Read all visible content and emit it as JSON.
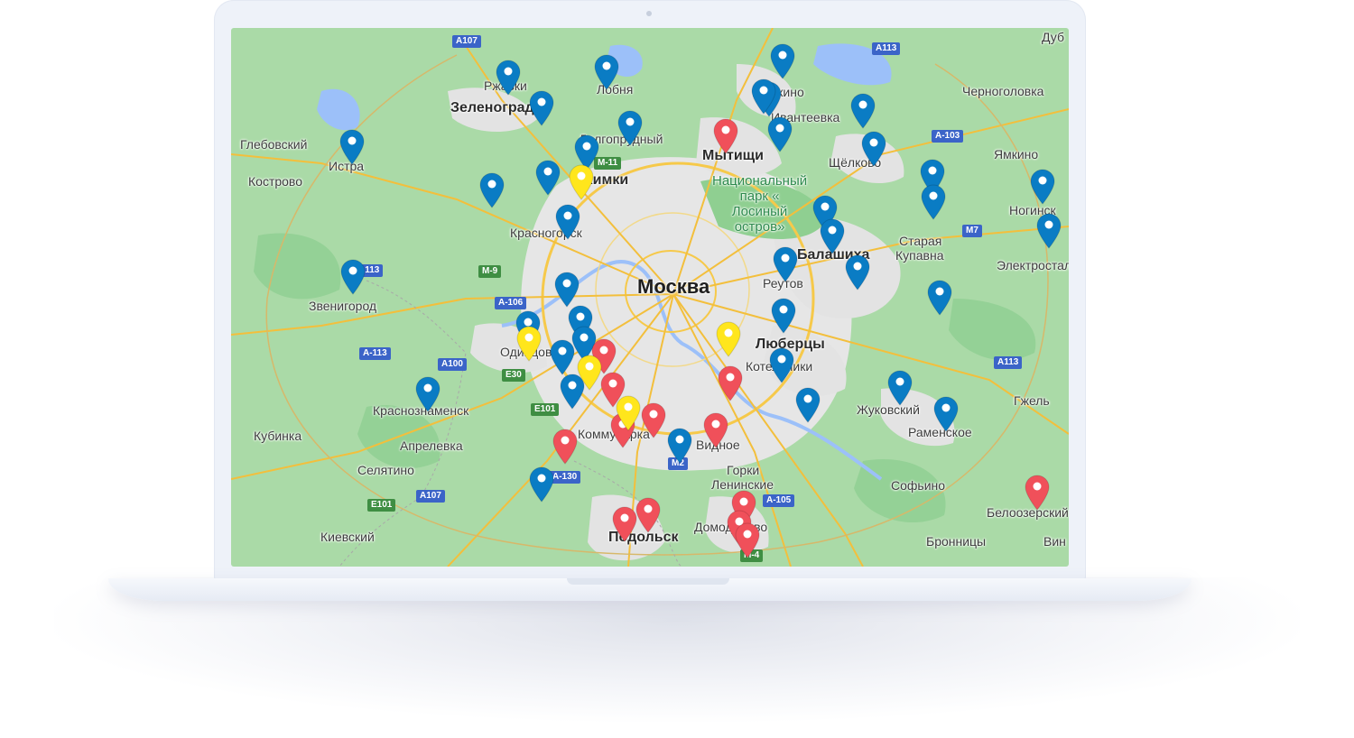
{
  "map": {
    "city_labels": [
      {
        "text": "Дуб",
        "cls": ""
      },
      {
        "text": "Ржавки",
        "cls": ""
      },
      {
        "text": "Лобня",
        "cls": ""
      },
      {
        "text": "Зеленоград",
        "cls": "big"
      },
      {
        "text": "Пушкино",
        "cls": ""
      },
      {
        "text": "Черноголовка",
        "cls": ""
      },
      {
        "text": "Ивантеевка",
        "cls": ""
      },
      {
        "text": "Глебовский",
        "cls": ""
      },
      {
        "text": "Долгопрудный",
        "cls": ""
      },
      {
        "text": "Мытищи",
        "cls": "big"
      },
      {
        "text": "Щёлково",
        "cls": ""
      },
      {
        "text": "Ямкино",
        "cls": ""
      },
      {
        "text": "Истра",
        "cls": ""
      },
      {
        "text": "Химки",
        "cls": "big"
      },
      {
        "text": "Кострово",
        "cls": ""
      },
      {
        "text": "Ногинск",
        "cls": ""
      },
      {
        "text": "Красногорск",
        "cls": ""
      },
      {
        "text": "Балашиха",
        "cls": "big"
      },
      {
        "text": "Старая",
        "cls": ""
      },
      {
        "text": "Купавна",
        "cls": ""
      },
      {
        "text": "Электросталь",
        "cls": ""
      },
      {
        "text": "Москва",
        "cls": "huge"
      },
      {
        "text": "Реутов",
        "cls": ""
      },
      {
        "text": "Звенигород",
        "cls": ""
      },
      {
        "text": "Одинцово",
        "cls": ""
      },
      {
        "text": "Люберцы",
        "cls": "big"
      },
      {
        "text": "Котельники",
        "cls": ""
      },
      {
        "text": "Гжель",
        "cls": ""
      },
      {
        "text": "Жуковский",
        "cls": ""
      },
      {
        "text": "Краснознаменск",
        "cls": ""
      },
      {
        "text": "Раменское",
        "cls": ""
      },
      {
        "text": "Кубинка",
        "cls": ""
      },
      {
        "text": "Коммунарка",
        "cls": ""
      },
      {
        "text": "Видное",
        "cls": ""
      },
      {
        "text": "Апрелевка",
        "cls": ""
      },
      {
        "text": "Горки",
        "cls": ""
      },
      {
        "text": "Ленинские",
        "cls": ""
      },
      {
        "text": "Селятино",
        "cls": ""
      },
      {
        "text": "Софьино",
        "cls": ""
      },
      {
        "text": "Белоозерский",
        "cls": ""
      },
      {
        "text": "Киевский",
        "cls": ""
      },
      {
        "text": "Домодедово",
        "cls": ""
      },
      {
        "text": "Подольск",
        "cls": "big"
      },
      {
        "text": "Бронницы",
        "cls": ""
      },
      {
        "text": "Вин",
        "cls": ""
      }
    ],
    "park_label": "Национальный\nпарк «\nЛосиный\nостров»",
    "road_shields": [
      {
        "text": "A107",
        "color": "blue"
      },
      {
        "text": "A113",
        "color": "blue"
      },
      {
        "text": "M-11",
        "color": "green"
      },
      {
        "text": "A-103",
        "color": "blue"
      },
      {
        "text": "M7",
        "color": "blue"
      },
      {
        "text": "A113",
        "color": "blue"
      },
      {
        "text": "M-9",
        "color": "green"
      },
      {
        "text": "A-106",
        "color": "blue"
      },
      {
        "text": "A-113",
        "color": "blue"
      },
      {
        "text": "A100",
        "color": "blue"
      },
      {
        "text": "E30",
        "color": "green"
      },
      {
        "text": "A113",
        "color": "blue"
      },
      {
        "text": "E101",
        "color": "green"
      },
      {
        "text": "M2",
        "color": "blue"
      },
      {
        "text": "A-130",
        "color": "blue"
      },
      {
        "text": "A107",
        "color": "blue"
      },
      {
        "text": "A-105",
        "color": "blue"
      },
      {
        "text": "E101",
        "color": "green"
      },
      {
        "text": "M-4",
        "color": "green"
      }
    ],
    "marker_colors": {
      "blue": "#0a7cc4",
      "red": "#f0505a",
      "yellow": "#ffe61c"
    },
    "markers": [
      {
        "color": "blue"
      },
      {
        "color": "blue"
      },
      {
        "color": "blue"
      },
      {
        "color": "blue"
      },
      {
        "color": "blue"
      },
      {
        "color": "blue"
      },
      {
        "color": "blue"
      },
      {
        "color": "blue"
      },
      {
        "color": "blue"
      },
      {
        "color": "blue"
      },
      {
        "color": "blue"
      },
      {
        "color": "blue"
      },
      {
        "color": "blue"
      },
      {
        "color": "blue"
      },
      {
        "color": "blue"
      },
      {
        "color": "blue"
      },
      {
        "color": "blue"
      },
      {
        "color": "blue"
      },
      {
        "color": "blue"
      },
      {
        "color": "blue"
      },
      {
        "color": "blue"
      },
      {
        "color": "blue"
      },
      {
        "color": "blue"
      },
      {
        "color": "blue"
      },
      {
        "color": "blue"
      },
      {
        "color": "blue"
      },
      {
        "color": "blue"
      },
      {
        "color": "blue"
      },
      {
        "color": "blue"
      },
      {
        "color": "blue"
      },
      {
        "color": "blue"
      },
      {
        "color": "blue"
      },
      {
        "color": "blue"
      },
      {
        "color": "blue"
      },
      {
        "color": "blue"
      },
      {
        "color": "blue"
      },
      {
        "color": "blue"
      },
      {
        "color": "blue"
      },
      {
        "color": "blue"
      },
      {
        "color": "red"
      },
      {
        "color": "red"
      },
      {
        "color": "red"
      },
      {
        "color": "red"
      },
      {
        "color": "red"
      },
      {
        "color": "red"
      },
      {
        "color": "red"
      },
      {
        "color": "red"
      },
      {
        "color": "red"
      },
      {
        "color": "red"
      },
      {
        "color": "red"
      },
      {
        "color": "red"
      },
      {
        "color": "red"
      },
      {
        "color": "red"
      },
      {
        "color": "yellow"
      },
      {
        "color": "yellow"
      },
      {
        "color": "yellow"
      },
      {
        "color": "yellow"
      },
      {
        "color": "yellow"
      }
    ]
  }
}
